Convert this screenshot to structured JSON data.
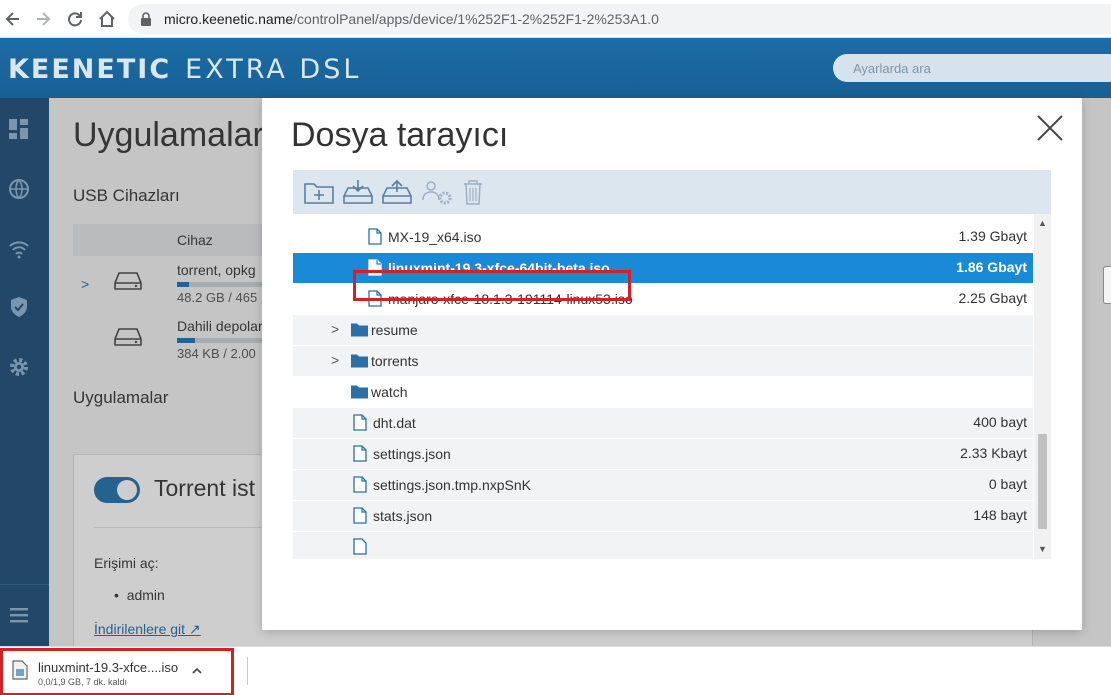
{
  "browser": {
    "url_host": "micro.keenetic.name",
    "url_path": "/controlPanel/apps/device/1%252F1-2%252F1-2%253A1.0"
  },
  "header": {
    "brand_main": "KEENETIC",
    "brand_model": "EXTRA DSL",
    "search_placeholder": "Ayarlarda ara"
  },
  "page": {
    "title": "Uygulamalar",
    "usb_section": "USB Cihazları",
    "device_column": "Cihaz",
    "devices": [
      {
        "name": "torrent, opkg",
        "size": "48.2 GB / 465",
        "usage_fraction": 0.1
      },
      {
        "name": "Dahili depolar",
        "size": "384 KB / 2.00",
        "usage_fraction": 0.15
      }
    ],
    "apps_section": "Uygulamalar",
    "torrent_title": "Torrent ist",
    "access_label": "Erişimi aç:",
    "access_user": "admin",
    "downloads_link": "İndirilenlere git"
  },
  "modal": {
    "title": "Dosya tarayıcı",
    "files": [
      {
        "name": "MX-19_x64.iso",
        "size": "1.39 Gbayt",
        "type": "file",
        "level": 2
      },
      {
        "name": "linuxmint-19.3-xfce-64bit-beta.iso",
        "size": "1.86 Gbayt",
        "type": "file",
        "level": 2,
        "selected": true
      },
      {
        "name": "manjaro-xfce-18.1.3-191114-linux53.iso",
        "size": "2.25 Gbayt",
        "type": "file",
        "level": 2
      },
      {
        "name": "resume",
        "size": "",
        "type": "folder",
        "expandable": true
      },
      {
        "name": "torrents",
        "size": "",
        "type": "folder",
        "expandable": true
      },
      {
        "name": "watch",
        "size": "",
        "type": "folder"
      },
      {
        "name": "dht.dat",
        "size": "400 bayt",
        "type": "file",
        "level": 1
      },
      {
        "name": "settings.json",
        "size": "2.33 Kbayt",
        "type": "file",
        "level": 1
      },
      {
        "name": "settings.json.tmp.nxpSnK",
        "size": "0 bayt",
        "type": "file",
        "level": 1
      },
      {
        "name": "stats.json",
        "size": "148 bayt",
        "type": "file",
        "level": 1
      }
    ],
    "toolbar": [
      "new-folder-icon",
      "download-icon",
      "upload-icon",
      "permissions-icon",
      "trash-icon"
    ]
  },
  "download_bar": {
    "file_name": "linuxmint-19.3-xfce....iso",
    "status": "0,0/1,9 GB, 7 dk. kaldı"
  },
  "colors": {
    "header": "#1d6ca5",
    "sidebar": "#1b4b74",
    "selected_row": "#1a8ad6",
    "highlight": "#d42027"
  }
}
